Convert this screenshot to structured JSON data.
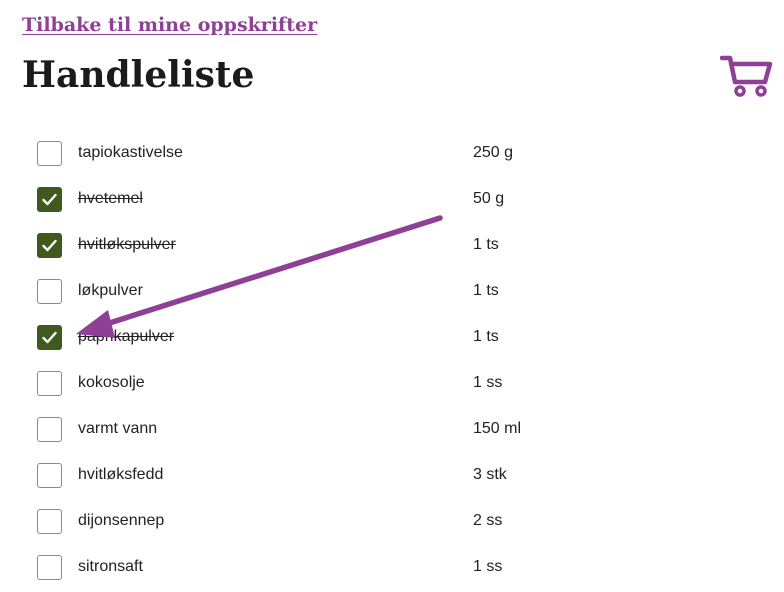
{
  "header": {
    "back_link": "Tilbake til mine oppskrifter",
    "title": "Handleliste",
    "cart_icon": "shopping-cart-icon"
  },
  "colors": {
    "accent": "#8e3f96",
    "checked": "#3e5a1e",
    "annotation_arrow": "#8e3f96"
  },
  "items": [
    {
      "name": "tapiokastivelse",
      "qty": "250 g",
      "checked": false
    },
    {
      "name": "hvetemel",
      "qty": "50 g",
      "checked": true
    },
    {
      "name": "hvitløkspulver",
      "qty": "1 ts",
      "checked": true
    },
    {
      "name": "løkpulver",
      "qty": "1 ts",
      "checked": false
    },
    {
      "name": "paprikapulver",
      "qty": "1 ts",
      "checked": true
    },
    {
      "name": "kokosolje",
      "qty": "1 ss",
      "checked": false
    },
    {
      "name": "varmt vann",
      "qty": "150 ml",
      "checked": false
    },
    {
      "name": "hvitløksfedd",
      "qty": "3 stk",
      "checked": false
    },
    {
      "name": "dijonsennep",
      "qty": "2 ss",
      "checked": false
    },
    {
      "name": "sitronsaft",
      "qty": "1 ss",
      "checked": false
    }
  ]
}
